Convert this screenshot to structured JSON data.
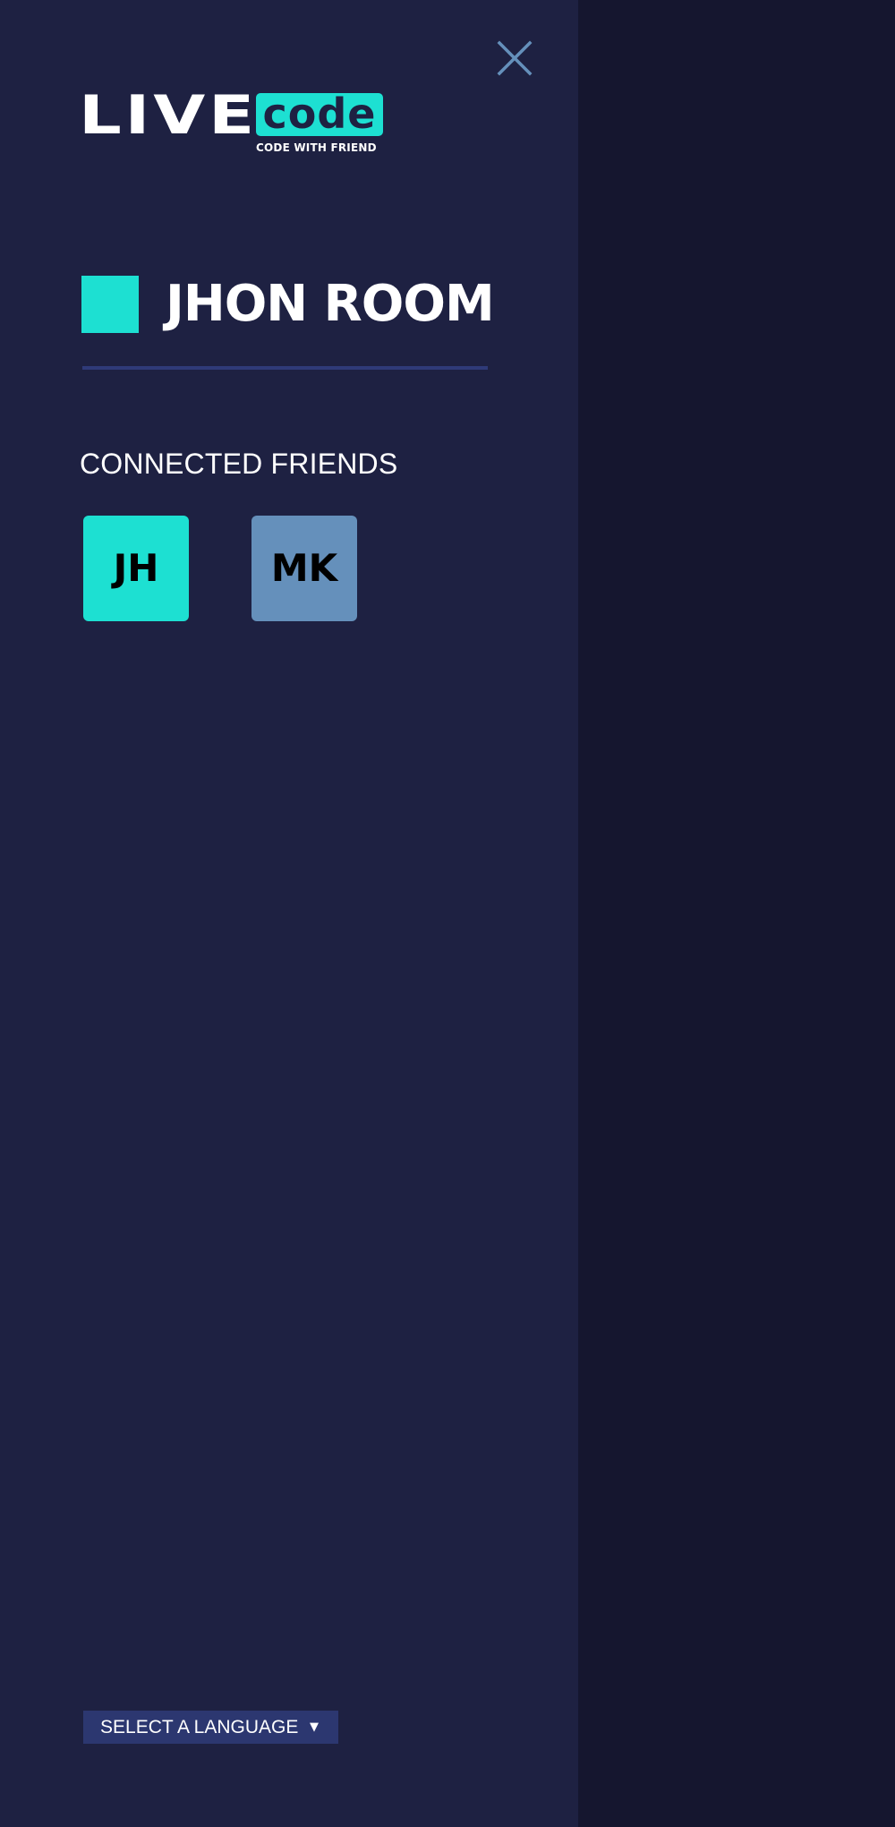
{
  "logo": {
    "live_text": "LIVE",
    "code_text": "code",
    "tagline": "CODE WITH FRIEND"
  },
  "room": {
    "title": "JHON ROOM"
  },
  "friends": {
    "heading": "CONNECTED FRIENDS",
    "items": [
      {
        "initials": "JH",
        "color": "#1de0d2"
      },
      {
        "initials": "MK",
        "color": "#6590bb"
      }
    ]
  },
  "language": {
    "selected_label": "SELECT A LANGUAGE",
    "caret_icon": "triangle-down-icon"
  },
  "close": {
    "icon": "close-icon"
  },
  "colors": {
    "sidebar_bg": "#1e2142",
    "main_bg": "#15162f",
    "accent": "#1de0d2",
    "divider": "#2f3a78",
    "secondary_tile": "#6590bb",
    "select_bg": "#2c3770",
    "close_icon": "#6590bb"
  }
}
